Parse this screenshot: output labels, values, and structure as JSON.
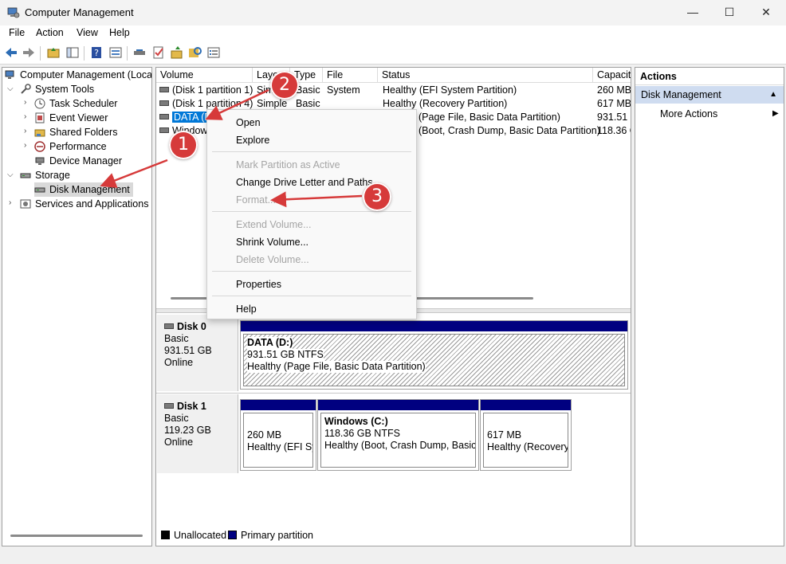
{
  "window": {
    "title": "Computer Management",
    "minimize": "—",
    "maximize": "☐",
    "close": "✕"
  },
  "menu": [
    "File",
    "Action",
    "View",
    "Help"
  ],
  "tree": {
    "root": "Computer Management (Local",
    "system_tools": "System Tools",
    "task_scheduler": "Task Scheduler",
    "event_viewer": "Event Viewer",
    "shared_folders": "Shared Folders",
    "performance": "Performance",
    "device_manager": "Device Manager",
    "storage": "Storage",
    "disk_management": "Disk Management",
    "services": "Services and Applications"
  },
  "volume_table": {
    "headers": [
      "Volume",
      "Layout",
      "Type",
      "File System",
      "Status",
      "Capacity"
    ],
    "header_visible": [
      "Volume",
      "Layo",
      "Type",
      "File System",
      "Status",
      "Capacit"
    ],
    "rows": [
      {
        "volume": "(Disk 1 partition 1)",
        "layout": "Simple",
        "type": "Basic",
        "fs": "",
        "status": "Healthy (EFI System Partition)",
        "capacity": "260 MB"
      },
      {
        "volume": "(Disk 1 partition 4)",
        "layout": "Simple",
        "type": "Basic",
        "fs": "",
        "status": "Healthy (Recovery Partition)",
        "capacity": "617 MB"
      },
      {
        "volume": "DATA (D:)",
        "layout": "",
        "type": "",
        "fs": "",
        "status": "(Page File, Basic Data Partition)",
        "capacity": "931.51 G"
      },
      {
        "volume": "Window",
        "layout": "",
        "type": "",
        "fs": "",
        "status": "(Boot, Crash Dump, Basic Data Partition)",
        "capacity": "118.36 G"
      }
    ],
    "row1_layout_visible": "Simp",
    "row3_volume_visible": "DATA (D"
  },
  "disks": [
    {
      "name": "Disk 0",
      "type": "Basic",
      "size": "931.51 GB",
      "state": "Online",
      "partitions": [
        {
          "label": "DATA  (D:)",
          "size": "931.51 GB NTFS",
          "status": "Healthy (Page File, Basic Data Partition)"
        }
      ]
    },
    {
      "name": "Disk 1",
      "type": "Basic",
      "size": "119.23 GB",
      "state": "Online",
      "partitions": [
        {
          "label": "",
          "size": "260 MB",
          "status": "Healthy (EFI Sys"
        },
        {
          "label": "Windows  (C:)",
          "size": "118.36 GB NTFS",
          "status": "Healthy (Boot, Crash Dump, Basic D"
        },
        {
          "label": "",
          "size": "617 MB",
          "status": "Healthy (Recovery"
        }
      ]
    }
  ],
  "legend": {
    "unallocated": "Unallocated",
    "primary": "Primary partition"
  },
  "actions": {
    "header": "Actions",
    "section": "Disk Management",
    "more": "More Actions"
  },
  "context_menu": {
    "open": "Open",
    "explore": "Explore",
    "mark_active": "Mark Partition as Active",
    "change_letter": "Change Drive Letter and Paths...",
    "format": "Format...",
    "extend": "Extend Volume...",
    "shrink": "Shrink Volume...",
    "delete": "Delete Volume...",
    "properties": "Properties",
    "help": "Help"
  },
  "annotations": [
    "1",
    "2",
    "3"
  ],
  "colors": {
    "primary_partition": "#000080",
    "annotation": "#d63a3a",
    "selection": "#0078d7"
  }
}
